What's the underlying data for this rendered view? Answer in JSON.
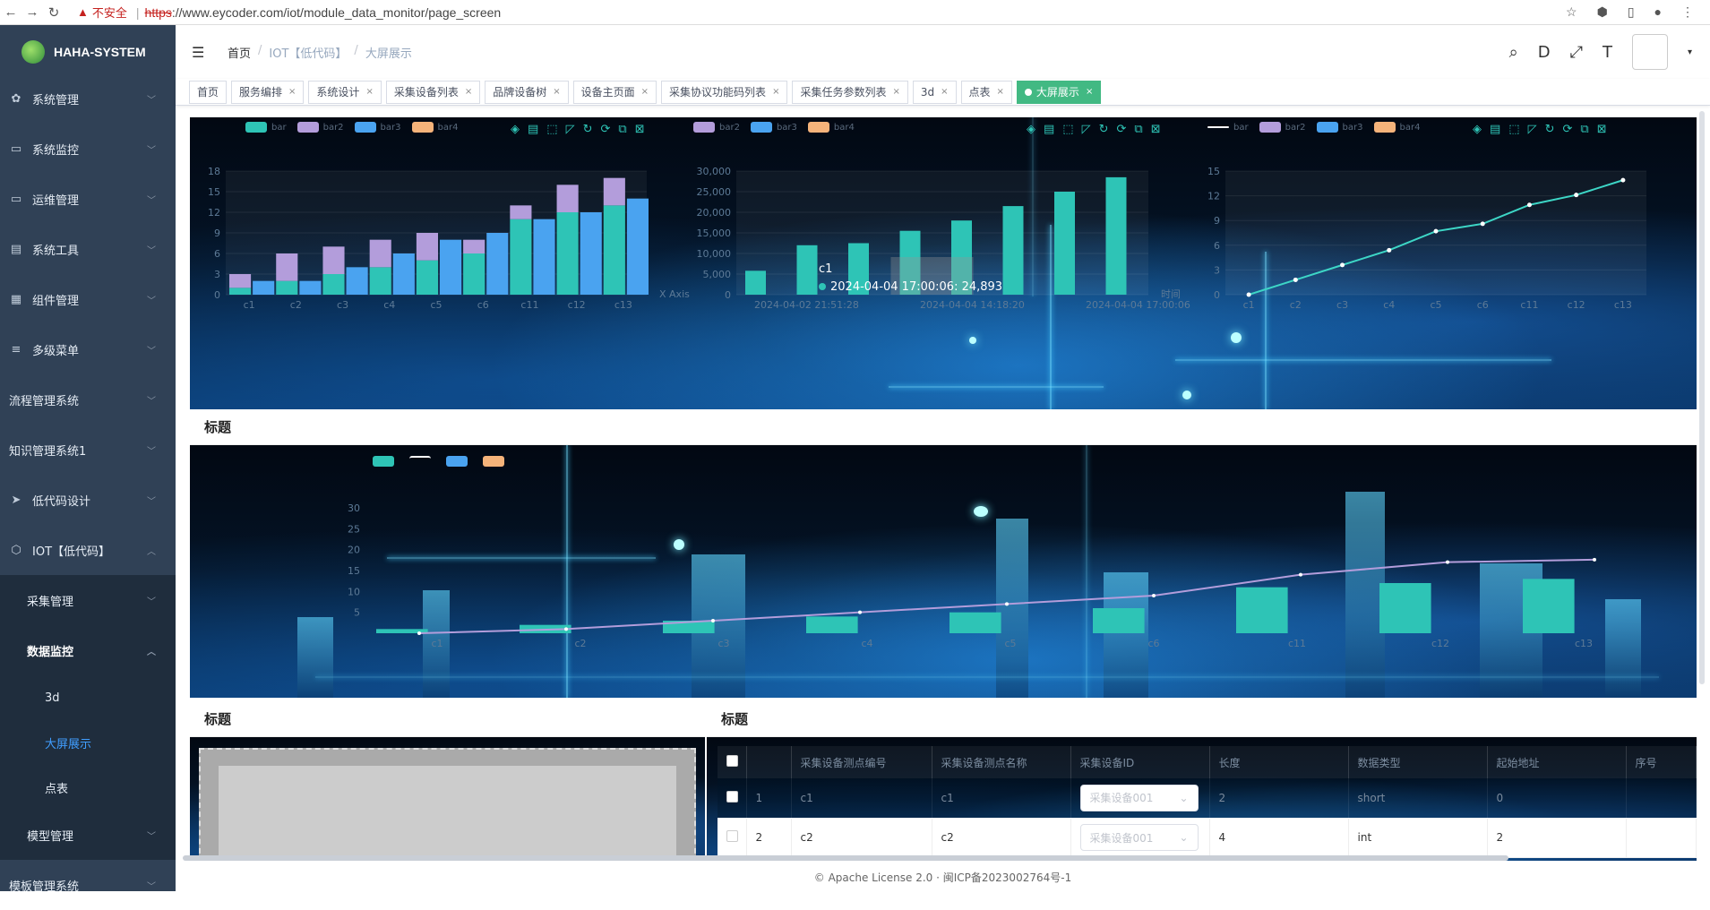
{
  "browser": {
    "insecure_label": "不安全",
    "scheme": "https",
    "url_rest": "://www.eycoder.com/iot/module_data_monitor/page_screen"
  },
  "sidebar": {
    "logo": "HAHA-SYSTEM",
    "items": [
      {
        "label": "系统管理",
        "icon": "gear-icon"
      },
      {
        "label": "系统监控",
        "icon": "monitor-icon"
      },
      {
        "label": "运维管理",
        "icon": "ops-icon"
      },
      {
        "label": "系统工具",
        "icon": "tool-icon"
      },
      {
        "label": "组件管理",
        "icon": "grid-icon"
      },
      {
        "label": "多级菜单",
        "icon": "list-icon"
      },
      {
        "label": "流程管理系统",
        "icon": ""
      },
      {
        "label": "知识管理系统1",
        "icon": ""
      },
      {
        "label": "低代码设计",
        "icon": "send-icon"
      },
      {
        "label": "IOT【低代码】",
        "icon": "cube-icon"
      }
    ],
    "iot_sub": [
      {
        "label": "采集管理"
      },
      {
        "label": "数据监控"
      }
    ],
    "monitor_sub": [
      {
        "label": "3d"
      },
      {
        "label": "大屏展示"
      },
      {
        "label": "点表"
      }
    ],
    "model_mgmt": "模型管理",
    "template_sys": "模板管理系统"
  },
  "breadcrumb": {
    "home": "首页",
    "iot": "IOT【低代码】",
    "current": "大屏展示"
  },
  "tags": [
    "首页",
    "服务编排",
    "系统设计",
    "采集设备列表",
    "品牌设备树",
    "设备主页面",
    "采集协议功能码列表",
    "采集任务参数列表",
    "3d",
    "点表",
    "大屏展示"
  ],
  "panels": {
    "title": "标题"
  },
  "legend": {
    "bar": "bar",
    "bar2": "bar2",
    "bar3": "bar3",
    "bar4": "bar4"
  },
  "colors": {
    "teal": "#2ec4b6",
    "purple": "#b39ddb",
    "blue": "#4aa3f0",
    "orange": "#f5b37a",
    "line": "#3dd6c6"
  },
  "chart_data": [
    {
      "type": "bar",
      "categories": [
        "c1",
        "c2",
        "c3",
        "c4",
        "c5",
        "c6",
        "c11",
        "c12",
        "c13"
      ],
      "xlabel": "X Axis",
      "ylim": [
        0,
        18
      ],
      "yticks": [
        0,
        3,
        6,
        9,
        12,
        15,
        18
      ],
      "series": [
        {
          "name": "bar",
          "values": [
            1,
            2,
            3,
            4,
            5,
            6,
            11,
            12,
            13
          ]
        },
        {
          "name": "bar2",
          "values": [
            2,
            4,
            4,
            4,
            4,
            2,
            2,
            4,
            4
          ]
        },
        {
          "name": "bar3",
          "values": [
            2,
            2,
            4,
            6,
            8,
            9,
            11,
            12,
            14
          ]
        }
      ]
    },
    {
      "type": "bar",
      "xlabel": "时间",
      "ylim": [
        0,
        30000
      ],
      "yticks": [
        "0",
        "5,000",
        "10,000",
        "15,000",
        "20,000",
        "25,000",
        "30,000"
      ],
      "xticks": [
        "2024-04-02 21:51:28",
        "2024-04-04 14:18:20",
        "2024-04-04 17:00:06"
      ],
      "values": [
        5800,
        12000,
        12500,
        15500,
        18000,
        21500,
        25000,
        28500
      ],
      "tooltip_title": "c1",
      "tooltip": "2024-04-04 17:00:06: 24,893"
    },
    {
      "type": "line",
      "categories": [
        "c1",
        "c2",
        "c3",
        "c4",
        "c5",
        "c6",
        "c11",
        "c12",
        "c13"
      ],
      "ylim": [
        0,
        15
      ],
      "yticks": [
        0,
        3,
        6,
        9,
        12,
        15
      ],
      "values": [
        0,
        1.8,
        3.6,
        5.4,
        7.7,
        8.6,
        10.9,
        12.1,
        13.9
      ]
    },
    {
      "type": "bar",
      "categories": [
        "c1",
        "c2",
        "c3",
        "c4",
        "c5",
        "c6",
        "c11",
        "c12",
        "c13"
      ],
      "ylim": [
        0,
        30
      ],
      "yticks": [
        5,
        10,
        15,
        20,
        25,
        30
      ],
      "series": [
        {
          "name": "bar",
          "values": [
            1,
            2,
            3,
            4,
            5,
            6,
            11,
            12,
            13
          ]
        },
        {
          "name": "bar2",
          "values": [
            0,
            1,
            3,
            5,
            7,
            9,
            14,
            17,
            17.6
          ]
        }
      ]
    }
  ],
  "table": {
    "headers": [
      "",
      "",
      "采集设备测点编号",
      "采集设备测点名称",
      "采集设备ID",
      "长度",
      "数据类型",
      "起始地址",
      "序号"
    ],
    "rows": [
      {
        "idx": "1",
        "code": "c1",
        "name": "c1",
        "device": "采集设备001",
        "len": "2",
        "type": "short",
        "addr": "0"
      },
      {
        "idx": "2",
        "code": "c2",
        "name": "c2",
        "device": "采集设备001",
        "len": "4",
        "type": "int",
        "addr": "2"
      }
    ]
  },
  "footer": "© Apache License 2.0 · 闽ICP备2023002764号-1"
}
